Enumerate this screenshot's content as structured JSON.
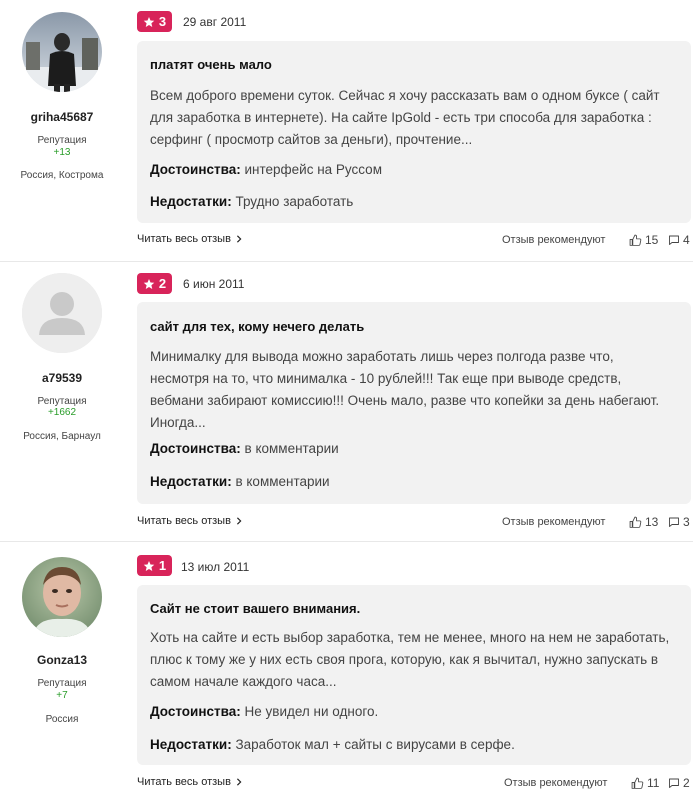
{
  "reviews": [
    {
      "username": "griha45687",
      "reputation_label": "Репутация",
      "reputation": "+13",
      "location": "Россия, Кострома",
      "rating": "3",
      "date": "29 авг 2011",
      "title": "платят очень мало",
      "body": "Всем доброго времени суток. Сейчас я хочу рассказать вам о одном буксе ( сайт для заработка в интернете). На сайте IpGold - есть три способа для заработка : серфинг ( просмотр сайтов за деньги), прочтение...",
      "pros_label": "Достоинства:",
      "pros": "интерфейс на Руссом",
      "cons_label": "Недостатки:",
      "cons": "Трудно заработать",
      "read_more": "Читать весь отзыв",
      "recommend": "Отзыв рекомендуют",
      "likes": "15",
      "comments": "4",
      "avatar_icon": "user-photo-winter"
    },
    {
      "username": "a79539",
      "reputation_label": "Репутация",
      "reputation": "+1662",
      "location": "Россия, Барнаул",
      "rating": "2",
      "date": "6 июн 2011",
      "title": "сайт для тех, кому нечего делать",
      "body": "Минималку для вывода можно заработать лишь через полгода разве что, несмотря на то, что минималка - 10 рублей!!! Так еще при выводе средств, вебмани забирают комиссию!!! Очень мало, разве что копейки за день набегают. Иногда...",
      "pros_label": "Достоинства:",
      "pros": "в комментарии",
      "cons_label": "Недостатки:",
      "cons": "в комментарии",
      "read_more": "Читать весь отзыв",
      "recommend": "Отзыв рекомендуют",
      "likes": "13",
      "comments": "3",
      "avatar_icon": "default-avatar"
    },
    {
      "username": "Gonza13",
      "reputation_label": "Репутация",
      "reputation": "+7",
      "location": "Россия",
      "rating": "1",
      "date": "13 июл 2011",
      "title": "Сайт не стоит вашего внимания.",
      "body": "Хоть на сайте и есть выбор заработка, тем не менее, много на нем не заработать, плюс к тому же у них есть своя прога, которую, как я вычитал, нужно запускать в самом начале каждого часа...",
      "pros_label": "Достоинства:",
      "pros": "Не увидел ни одного.",
      "cons_label": "Недостатки:",
      "cons": "Заработок мал + сайты с вирусами в серфе.",
      "read_more": "Читать весь отзыв",
      "recommend": "Отзыв рекомендуют",
      "likes": "11",
      "comments": "2",
      "avatar_icon": "user-photo-face"
    }
  ],
  "colors": {
    "badge": "#d8245a",
    "reputation": "#2a9d2a",
    "card_bg": "#f2f2f2"
  }
}
